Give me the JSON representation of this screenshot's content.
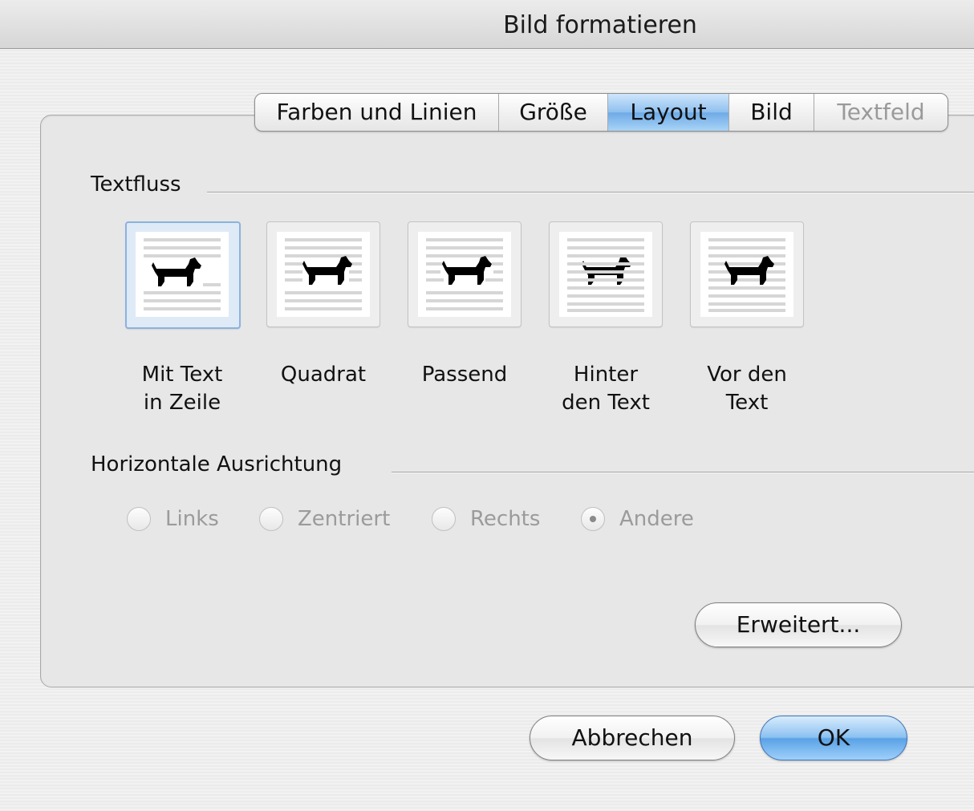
{
  "window": {
    "title": "Bild formatieren"
  },
  "tabs": [
    {
      "label": "Farben und Linien",
      "state": "normal"
    },
    {
      "label": "Größe",
      "state": "normal"
    },
    {
      "label": "Layout",
      "state": "selected"
    },
    {
      "label": "Bild",
      "state": "normal"
    },
    {
      "label": "Textfeld",
      "state": "disabled"
    }
  ],
  "textflow": {
    "heading": "Textfluss",
    "options": [
      {
        "line1": "Mit Text",
        "line2": "in Zeile",
        "selected": true,
        "icon": "inline-dog-icon"
      },
      {
        "line1": "Quadrat",
        "line2": "",
        "selected": false,
        "icon": "square-wrap-dog-icon"
      },
      {
        "line1": "Passend",
        "line2": "",
        "selected": false,
        "icon": "tight-wrap-dog-icon"
      },
      {
        "line1": "Hinter",
        "line2": "den Text",
        "selected": false,
        "icon": "behind-text-dog-icon"
      },
      {
        "line1": "Vor den",
        "line2": "Text",
        "selected": false,
        "icon": "in-front-dog-icon"
      }
    ]
  },
  "alignment": {
    "heading": "Horizontale Ausrichtung",
    "options": [
      {
        "label": "Links",
        "checked": false,
        "enabled": false
      },
      {
        "label": "Zentriert",
        "checked": false,
        "enabled": false
      },
      {
        "label": "Rechts",
        "checked": false,
        "enabled": false
      },
      {
        "label": "Andere",
        "checked": true,
        "enabled": false
      }
    ]
  },
  "buttons": {
    "advanced": "Erweitert...",
    "cancel": "Abbrechen",
    "ok": "OK"
  },
  "colors": {
    "selected_tab": "#6eaae6",
    "default_button": "#5aa2e6",
    "disabled_text": "#9b9b9b"
  }
}
